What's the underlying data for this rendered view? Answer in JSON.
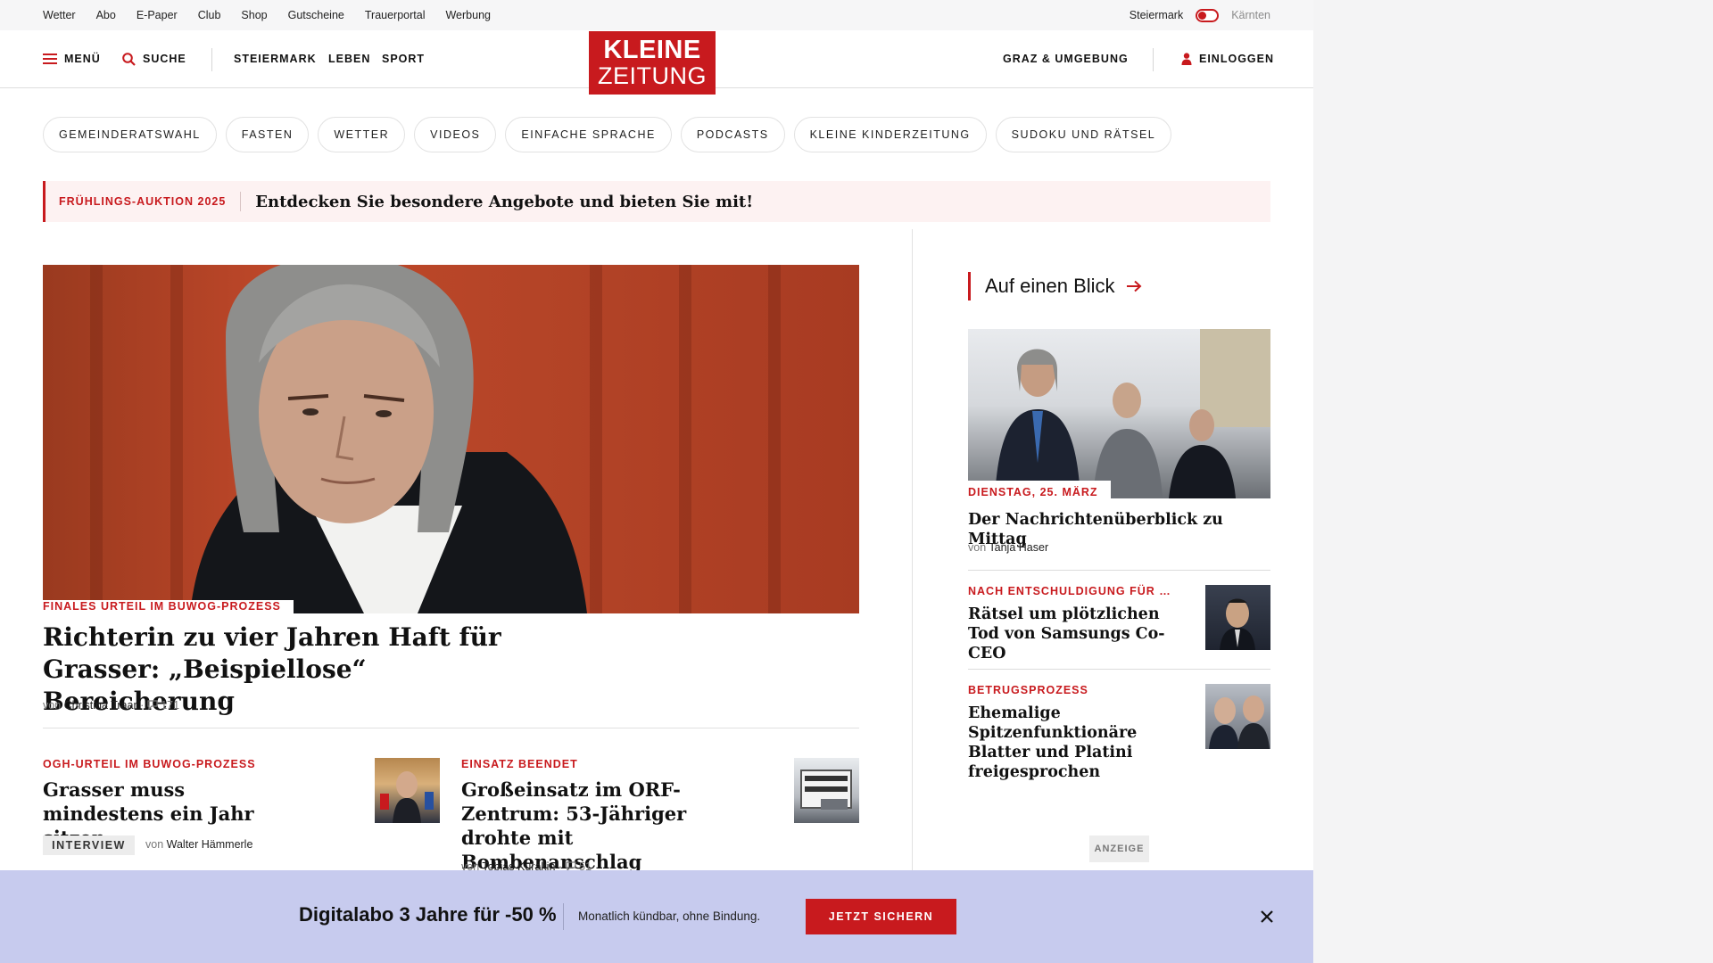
{
  "topbar": {
    "links": [
      "Wetter",
      "Abo",
      "E-Paper",
      "Club",
      "Shop",
      "Gutscheine",
      "Trauerportal",
      "Werbung"
    ],
    "region_active": "Steiermark",
    "region_inactive": "Kärnten"
  },
  "header": {
    "menu": "MENÜ",
    "search": "SUCHE",
    "nav": [
      "STEIERMARK",
      "LEBEN",
      "SPORT"
    ],
    "logo_line1": "KLEINE",
    "logo_line2": "ZEITUNG",
    "region_link": "GRAZ & UMGEBUNG",
    "login": "EINLOGGEN"
  },
  "tags": [
    "GEMEINDERATSWAHL",
    "FASTEN",
    "WETTER",
    "VIDEOS",
    "EINFACHE SPRACHE",
    "PODCASTS",
    "KLEINE KINDERZEITUNG",
    "SUDOKU UND RÄTSEL"
  ],
  "promo": {
    "kicker": "FRÜHLINGS-AUKTION 2025",
    "text": "Entdecken Sie besondere Angebote und bieten Sie mit!"
  },
  "hero": {
    "kicker": "FINALES URTEIL IM BUWOG-PROZESS",
    "headline": "Richterin zu vier Jahren Haft für Grasser: „Beispiellose“ Bereicherung",
    "by": "von",
    "author": "Christina Traar",
    "comments": "171"
  },
  "articles": [
    {
      "kicker": "OGH-URTEIL IM BUWOG-PROZESS",
      "headline": "Grasser muss mindestens ein Jahr sitzen",
      "badge": "INTERVIEW",
      "by": "von",
      "author": "Walter Hämmerle"
    },
    {
      "kicker": "EINSATZ BEENDET",
      "headline": "Großeinsatz im ORF-Zentrum: 53-Jähriger drohte mit Bombenanschlag",
      "by": "von",
      "author": "Tobias Kurakin",
      "comments": "51"
    }
  ],
  "sidebar": {
    "title": "Auf einen Blick",
    "lead": {
      "date": "DIENSTAG, 25. MÄRZ",
      "headline": "Der Nachrichtenüberblick zu Mittag",
      "by": "von",
      "author": "Tanja Haser"
    },
    "items": [
      {
        "kicker": "NACH ENTSCHULDIGUNG FÜR …",
        "headline": "Rätsel um plötzlichen Tod von Samsungs Co-CEO"
      },
      {
        "kicker": "BETRUGSPROZESS",
        "headline": "Ehemalige Spitzenfunktionäre Blatter und Platini freigesprochen"
      }
    ],
    "ad_label": "ANZEIGE"
  },
  "banner": {
    "title": "Digitalabo 3 Jahre für -50 %",
    "subtitle": "Monatlich kündbar, ohne Bindung.",
    "cta": "JETZT SICHERN"
  },
  "colors": {
    "brand_red": "#c81a1e",
    "banner_bg": "#c7cbee",
    "promo_bg": "#fdf2f2"
  }
}
